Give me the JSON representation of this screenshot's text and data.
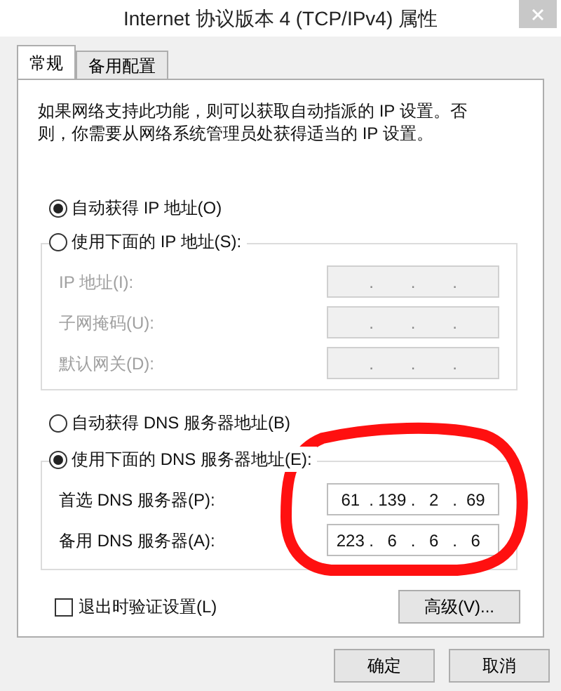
{
  "window": {
    "title": "Internet 协议版本 4 (TCP/IPv4) 属性"
  },
  "tabs": [
    {
      "label": "常规",
      "selected": true
    },
    {
      "label": "备用配置",
      "selected": false
    }
  ],
  "description": "如果网络支持此功能，则可以获取自动指派的 IP 设置。否则，你需要从网络系统管理员处获得适当的 IP 设置。",
  "octet_separator": ".",
  "ip_mode": [
    {
      "label": "自动获得 IP 地址(O)",
      "selected": true
    },
    {
      "label": "使用下面的 IP 地址(S):",
      "selected": false
    }
  ],
  "ip_fields": [
    {
      "label": "IP 地址(I):",
      "disabled": true
    },
    {
      "label": "子网掩码(U):",
      "disabled": true
    },
    {
      "label": "默认网关(D):",
      "disabled": true
    }
  ],
  "dns_mode": [
    {
      "label": "自动获得 DNS 服务器地址(B)",
      "selected": false
    },
    {
      "label": "使用下面的 DNS 服务器地址(E):",
      "selected": true
    }
  ],
  "dns_fields": [
    {
      "label": "首选 DNS 服务器(P):",
      "disabled": false,
      "octets": [
        "61",
        "139",
        "2",
        "69"
      ]
    },
    {
      "label": "备用 DNS 服务器(A):",
      "disabled": false,
      "octets": [
        "223",
        "6",
        "6",
        "6"
      ]
    }
  ],
  "validate_on_exit": {
    "label": "退出时验证设置(L)",
    "checked": false
  },
  "advanced_button": "高级(V)...",
  "buttons": [
    "确定",
    "取消"
  ],
  "annotation": {
    "kind": "ellipse"
  }
}
